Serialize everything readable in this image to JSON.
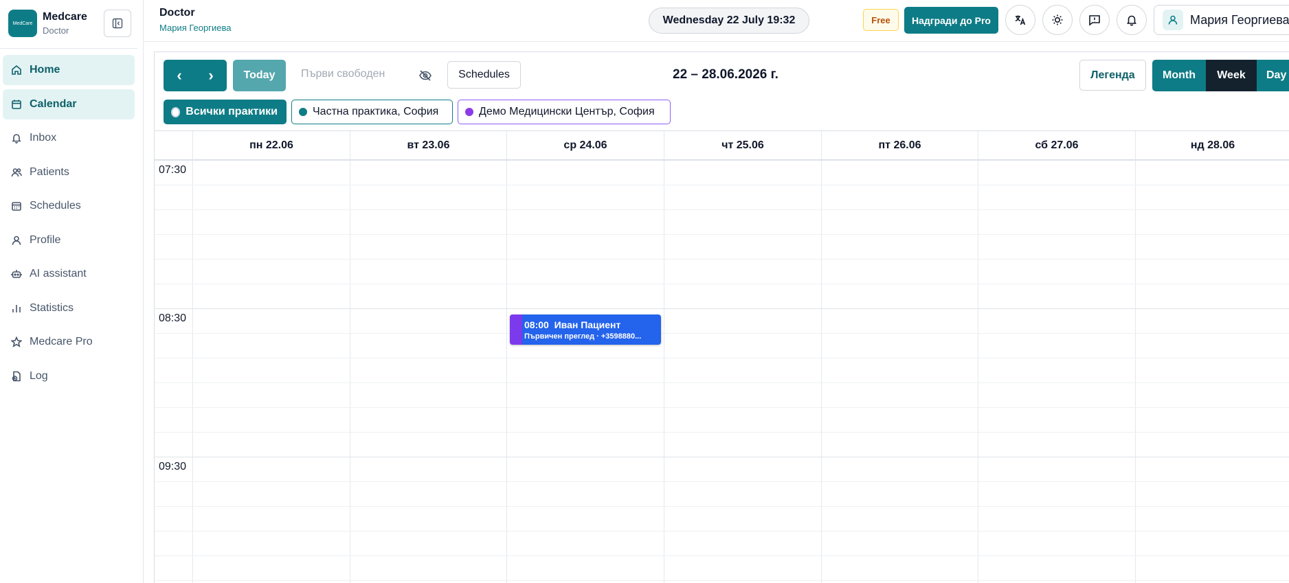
{
  "brand": {
    "logo_text": "MedCare",
    "name": "Medcare",
    "role": "Doctor"
  },
  "sidebar": {
    "items": [
      {
        "label": "Home",
        "icon": "home-icon",
        "active": true
      },
      {
        "label": "Calendar",
        "icon": "calendar-icon",
        "active": true
      },
      {
        "label": "Inbox",
        "icon": "bell-icon",
        "active": false
      },
      {
        "label": "Patients",
        "icon": "users-icon",
        "active": false
      },
      {
        "label": "Schedules",
        "icon": "calendar-grid-icon",
        "active": false
      },
      {
        "label": "Profile",
        "icon": "user-icon",
        "active": false
      },
      {
        "label": "AI assistant",
        "icon": "bot-icon",
        "active": false
      },
      {
        "label": "Statistics",
        "icon": "bar-chart-icon",
        "active": false
      },
      {
        "label": "Medcare Pro",
        "icon": "star-icon",
        "active": false
      },
      {
        "label": "Log",
        "icon": "log-icon",
        "active": false
      }
    ]
  },
  "header": {
    "title": "Doctor",
    "subtitle": "Мария Георгиева",
    "datetime": "Wednesday 22 July 19:32",
    "plan_badge": "Free",
    "upgrade_label": "Надгради до Pro",
    "user_name": "Мария Георгиева"
  },
  "toolbar": {
    "prev_label": "‹",
    "next_label": "›",
    "today_label": "Today",
    "first_free_label": "Първи свободен",
    "schedules_label": "Schedules",
    "range_label": "22 – 28.06.2026 г.",
    "legend_label": "Легенда",
    "views": {
      "month": "Month",
      "week": "Week",
      "day": "Day"
    }
  },
  "filters": {
    "all": "Всички практики",
    "private": "Частна практика, София",
    "demo": "Демо Медицински Център, София"
  },
  "days": [
    "пн 22.06",
    "вт 23.06",
    "ср 24.06",
    "чт 25.06",
    "пт 26.06",
    "сб 27.06",
    "нд 28.06"
  ],
  "times": [
    "07:30",
    "08:30",
    "09:30"
  ],
  "event": {
    "time": "08:00",
    "patient": "Иван Пациент",
    "details": "Първичен преглед · +3598880..."
  },
  "colors": {
    "primary": "#0e7c86",
    "dark": "#14222e",
    "event_blue": "#2463eb",
    "event_purple": "#7c3aed"
  }
}
